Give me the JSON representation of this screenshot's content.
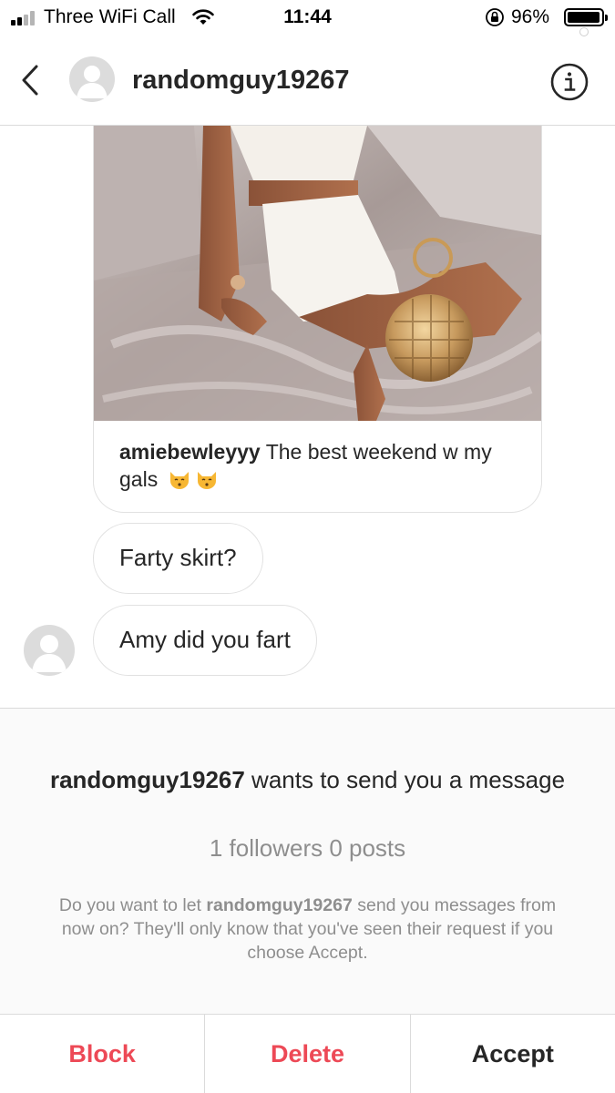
{
  "status_bar": {
    "carrier": "Three WiFi Call",
    "time": "11:44",
    "battery_percent": "96%",
    "battery_level": 0.96,
    "icons": [
      "signal-icon",
      "wifi-icon",
      "rotation-lock-icon",
      "battery-icon"
    ]
  },
  "header": {
    "username": "randomguy19267",
    "icons": [
      "back-chevron-icon",
      "avatar-placeholder-icon",
      "info-icon"
    ]
  },
  "messages": {
    "shared_post": {
      "caption_user": "amiebewleyyy",
      "caption_text": " The best weekend w my gals",
      "emoji": [
        "kissing-cat-emoji",
        "kissing-cat-emoji"
      ]
    },
    "bubbles": [
      {
        "text": "Farty skirt?"
      },
      {
        "text": "Amy did you fart"
      }
    ]
  },
  "request": {
    "username": "randomguy19267",
    "title_suffix": " wants to send you a message",
    "stats": "1 followers 0 posts",
    "desc_prefix": "Do you want to let ",
    "desc_user": "randomguy19267",
    "desc_suffix": " send you messages from now on? They'll only know that you've seen their request if you choose Accept."
  },
  "actions": {
    "block": "Block",
    "delete": "Delete",
    "accept": "Accept"
  },
  "colors": {
    "destructive": "#ed4956",
    "primary_text": "#262626",
    "secondary_text": "#8e8e8e",
    "divider": "#dbdbdb",
    "panel_bg": "#fafafa"
  }
}
